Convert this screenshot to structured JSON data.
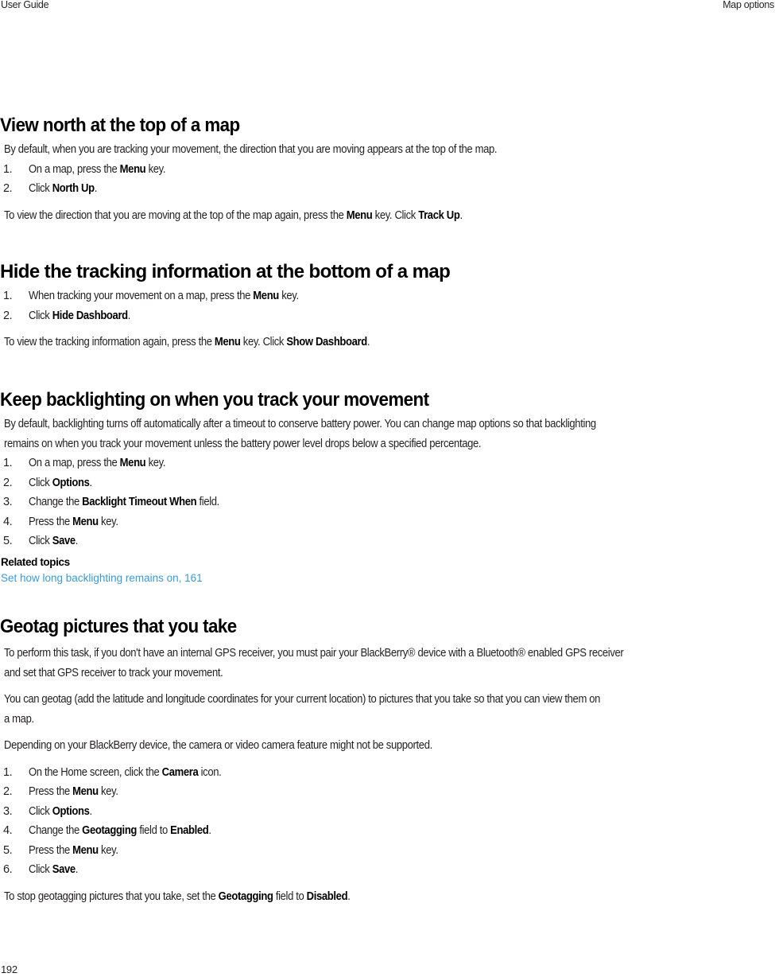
{
  "header": {
    "left": "User Guide",
    "right": "Map options"
  },
  "page_number": "192",
  "colors": {
    "link": "#3a9ad9",
    "text": "#231f20"
  },
  "sections": [
    {
      "title": "View north at the top of a map",
      "intro": "By default, when you are tracking your movement, the direction that you are moving appears at the top of the map.",
      "steps": [
        {
          "n": "1.",
          "pre": "On a map, press the ",
          "bold": "Menu",
          "post": " key."
        },
        {
          "n": "2.",
          "pre": "Click ",
          "bold": "North Up",
          "post": "."
        }
      ],
      "note": {
        "pre": "To view the direction that you are moving at the top of the map again, press the ",
        "b1": "Menu",
        "mid": " key. Click ",
        "b2": "Track Up",
        "post": "."
      }
    },
    {
      "title": "Hide the tracking information at the bottom of a map",
      "steps": [
        {
          "n": "1.",
          "pre": "When tracking your movement on a map, press the ",
          "bold": "Menu",
          "post": " key."
        },
        {
          "n": "2.",
          "pre": "Click ",
          "bold": "Hide Dashboard",
          "post": "."
        }
      ],
      "note": {
        "pre": "To view the tracking information again, press the ",
        "b1": "Menu",
        "mid": " key. Click ",
        "b2": "Show Dashboard",
        "post": "."
      }
    },
    {
      "title": "Keep backlighting on when you track your movement",
      "intro_line1": "By default, backlighting turns off automatically after a timeout to conserve battery power. You can change map options so that backlighting",
      "intro_line2": "remains on when you track your movement unless the battery power level drops below a specified percentage.",
      "steps": [
        {
          "n": "1.",
          "pre": "On a map, press the ",
          "bold": "Menu",
          "post": " key."
        },
        {
          "n": "2.",
          "pre": "Click ",
          "bold": "Options",
          "post": "."
        },
        {
          "n": "3.",
          "pre": "Change the ",
          "bold": "Backlight Timeout When",
          "post": " field."
        },
        {
          "n": "4.",
          "pre": "Press the ",
          "bold": "Menu",
          "post": " key."
        },
        {
          "n": "5.",
          "pre": "Click ",
          "bold": "Save",
          "post": "."
        }
      ],
      "related_title": "Related topics",
      "related_link": "Set how long backlighting remains on, 161"
    },
    {
      "title": "Geotag pictures that you take",
      "para1_line1": "To perform this task, if you don't have an internal GPS receiver, you must pair your BlackBerry® device with a Bluetooth® enabled GPS receiver",
      "para1_line2": "and set that GPS receiver to track your movement.",
      "para2_line1": "You can geotag (add the latitude and longitude coordinates for your current location) to pictures that you take so that you can view them on",
      "para2_line2": "a map.",
      "para3": "Depending on your BlackBerry device, the camera or video camera feature might not be supported.",
      "steps": [
        {
          "n": "1.",
          "pre": "On the Home screen, click the ",
          "bold": "Camera",
          "post": " icon."
        },
        {
          "n": "2.",
          "pre": "Press the ",
          "bold": "Menu",
          "post": " key."
        },
        {
          "n": "3.",
          "pre": "Click ",
          "bold": "Options",
          "post": "."
        },
        {
          "n": "4.",
          "pre": "Change the ",
          "bold": "Geotagging",
          "post": " field to ",
          "bold2": "Enabled",
          "post2": "."
        },
        {
          "n": "5.",
          "pre": "Press the ",
          "bold": "Menu",
          "post": " key."
        },
        {
          "n": "6.",
          "pre": "Click ",
          "bold": "Save",
          "post": "."
        }
      ],
      "note": {
        "pre": "To stop geotagging pictures that you take, set the ",
        "b1": "Geotagging",
        "mid": " field to ",
        "b2": "Disabled",
        "post": "."
      }
    }
  ]
}
